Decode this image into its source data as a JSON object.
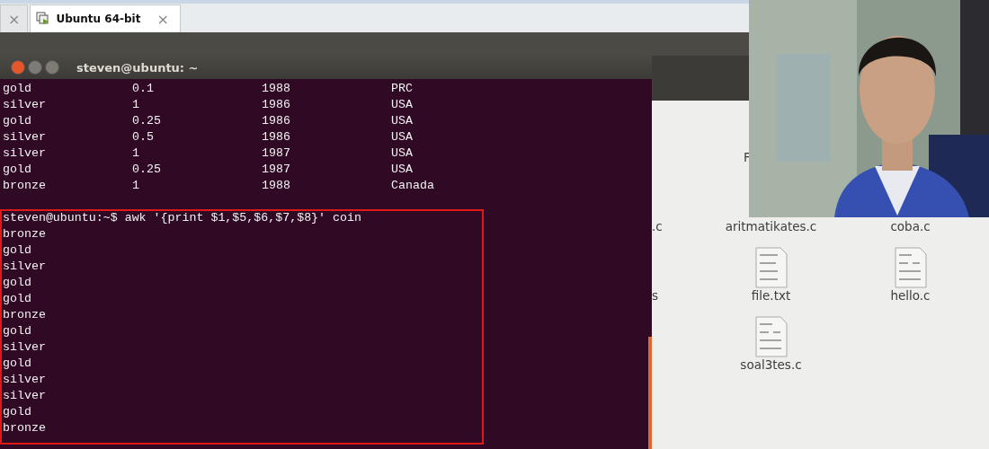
{
  "host_tabs": [
    {
      "close": "×",
      "selected": false
    },
    {
      "label": "Ubuntu 64-bit",
      "close": "×",
      "selected": true
    }
  ],
  "terminal": {
    "title": "steven@ubuntu: ~",
    "rows": [
      [
        "gold",
        "0.1",
        "1988",
        "PRC"
      ],
      [
        "silver",
        "1",
        "1986",
        "USA"
      ],
      [
        "gold",
        "0.25",
        "1986",
        "USA"
      ],
      [
        "silver",
        "0.5",
        "1986",
        "USA"
      ],
      [
        "silver",
        "1",
        "1987",
        "USA"
      ],
      [
        "gold",
        "0.25",
        "1987",
        "USA"
      ],
      [
        "bronze",
        "1",
        "1988",
        "Canada"
      ]
    ],
    "prompt": "steven@ubuntu:~$ awk '{print $1,$5,$6,$7,$8}' coin",
    "output": [
      "bronze",
      "gold",
      "silver",
      "gold",
      "gold",
      "bronze",
      "gold",
      "silver",
      "gold",
      "silver",
      "silver",
      "gold",
      "bronze"
    ],
    "highlight": true
  },
  "files": [
    [
      {
        "kind": "empty"
      },
      {
        "name": "F",
        "kind": "cut"
      }
    ],
    [
      {
        "name": ".c",
        "kind": "cut"
      },
      {
        "name": "aritmatikates.c",
        "kind": "covered"
      },
      {
        "name": "coba.c",
        "kind": "covered"
      }
    ],
    [
      {
        "name": "s",
        "kind": "cut"
      },
      {
        "name": "file.txt",
        "kind": "text"
      },
      {
        "name": "hello.c",
        "kind": "binary"
      }
    ],
    [
      {
        "kind": "empty"
      },
      {
        "name": "soal3tes.c",
        "kind": "binary"
      }
    ]
  ],
  "webcam": {
    "kind": "picture"
  }
}
